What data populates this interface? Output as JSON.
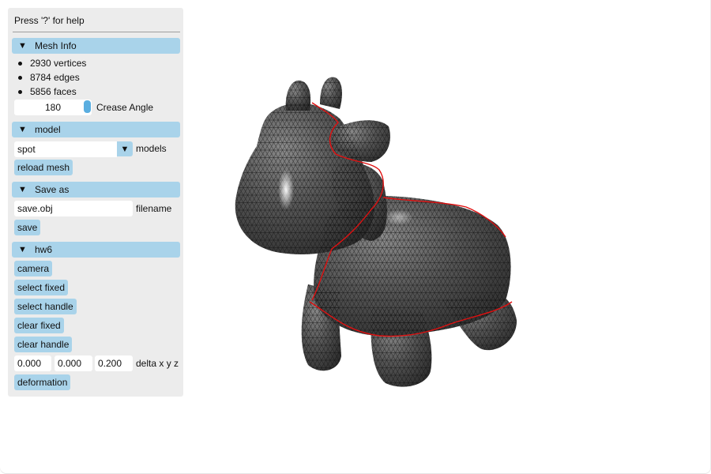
{
  "help_text": "Press '?' for help",
  "mesh_info": {
    "header": "Mesh Info",
    "items": [
      "2930 vertices",
      "8784 edges",
      "5856 faces"
    ],
    "crease_angle_value": "180",
    "crease_angle_label": "Crease Angle"
  },
  "model": {
    "header": "model",
    "selected": "spot",
    "label": "models",
    "reload_label": "reload mesh"
  },
  "save_as": {
    "header": "Save as",
    "filename_value": "save.obj",
    "filename_label": "filename",
    "save_label": "save"
  },
  "hw6": {
    "header": "hw6",
    "buttons": [
      "camera",
      "select fixed",
      "select handle",
      "clear fixed",
      "clear handle"
    ],
    "delta_values": [
      "0.000",
      "0.000",
      "0.200"
    ],
    "delta_label": "delta x y z",
    "deformation_label": "deformation"
  },
  "icons": {
    "collapse": "triangle-down-icon",
    "dropdown": "triangle-down-icon"
  },
  "colors": {
    "panel_bg": "#ececec",
    "header_bg": "#a9d3ea",
    "slider_knob": "#5aaee0",
    "mesh_fill": "#4a4a4a",
    "crease_lines": "#e01010"
  }
}
